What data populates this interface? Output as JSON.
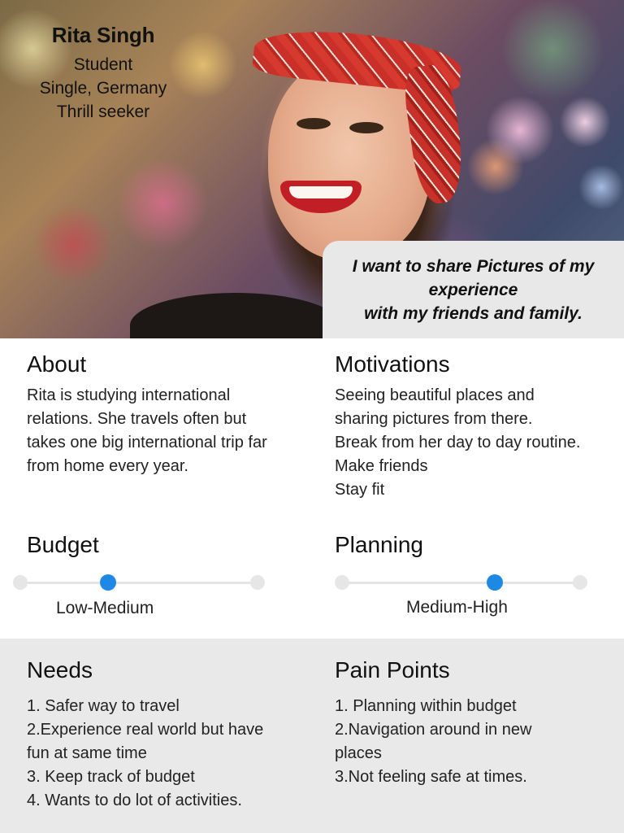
{
  "persona": {
    "name": "Rita Singh",
    "details": [
      "Student",
      "Single, Germany",
      "Thrill seeker"
    ],
    "quote_lines": [
      "I want to share Pictures of my",
      "experience",
      "with my friends and family."
    ]
  },
  "about": {
    "heading": "About",
    "lines": [
      "Rita is studying international",
      "relations. She travels often but",
      "takes one big international trip far",
      "from home every year."
    ]
  },
  "motivations": {
    "heading": "Motivations",
    "lines": [
      "Seeing beautiful places and",
      "sharing pictures from there.",
      "Break from her day to day routine.",
      "Make friends",
      "Stay fit"
    ]
  },
  "budget": {
    "heading": "Budget",
    "level_label": "Low-Medium",
    "level_fraction": 0.37
  },
  "planning": {
    "heading": "Planning",
    "level_label": "Medium-High",
    "level_fraction": 0.64
  },
  "needs": {
    "heading": "Needs",
    "lines": [
      "1. Safer way to travel",
      "2.Experience real world but have",
      "fun at same time",
      "3. Keep track of budget",
      "4. Wants to do lot of activities."
    ]
  },
  "pain_points": {
    "heading": "Pain Points",
    "lines": [
      "1. Planning within budget",
      "2.Navigation around in new",
      "places",
      "3.Not feeling safe at times."
    ]
  },
  "colors": {
    "accent": "#1e88e5",
    "quote_bg": "#e8e8e8",
    "bottom_bg": "#e9e9e9",
    "track": "#e4e4e4"
  }
}
